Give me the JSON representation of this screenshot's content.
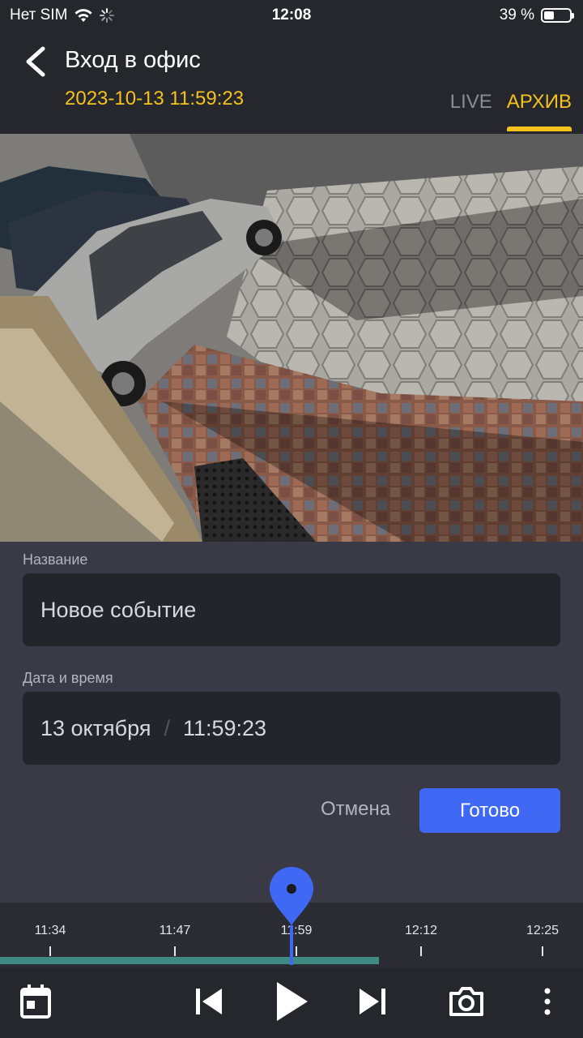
{
  "status_bar": {
    "carrier": "Нет SIM",
    "time": "12:08",
    "battery_percent": "39 %",
    "battery_level": 0.39
  },
  "header": {
    "title": "Вход в офис",
    "datetime": "2023-10-13 11:59:23",
    "tabs": [
      {
        "label": "LIVE",
        "active": false
      },
      {
        "label": "АРХИВ",
        "active": true
      }
    ]
  },
  "form": {
    "name_label": "Название",
    "name_value": "Новое событие",
    "datetime_label": "Дата и время",
    "date_value": "13 октября",
    "date_separator": "/",
    "time_value": "11:59:23",
    "cancel_label": "Отмена",
    "done_label": "Готово"
  },
  "timeline": {
    "ticks": [
      "11:34",
      "11:47",
      "11:59",
      "12:12",
      "12:25"
    ],
    "recorded_fraction": 0.65
  },
  "toolbar": {
    "icons": [
      "calendar-icon",
      "skip-previous-icon",
      "play-icon",
      "skip-next-icon",
      "camera-icon",
      "more-vertical-icon"
    ]
  },
  "colors": {
    "accent_yellow": "#f4c21d",
    "accent_blue": "#3f68f5",
    "track_teal": "#3f8a82"
  }
}
